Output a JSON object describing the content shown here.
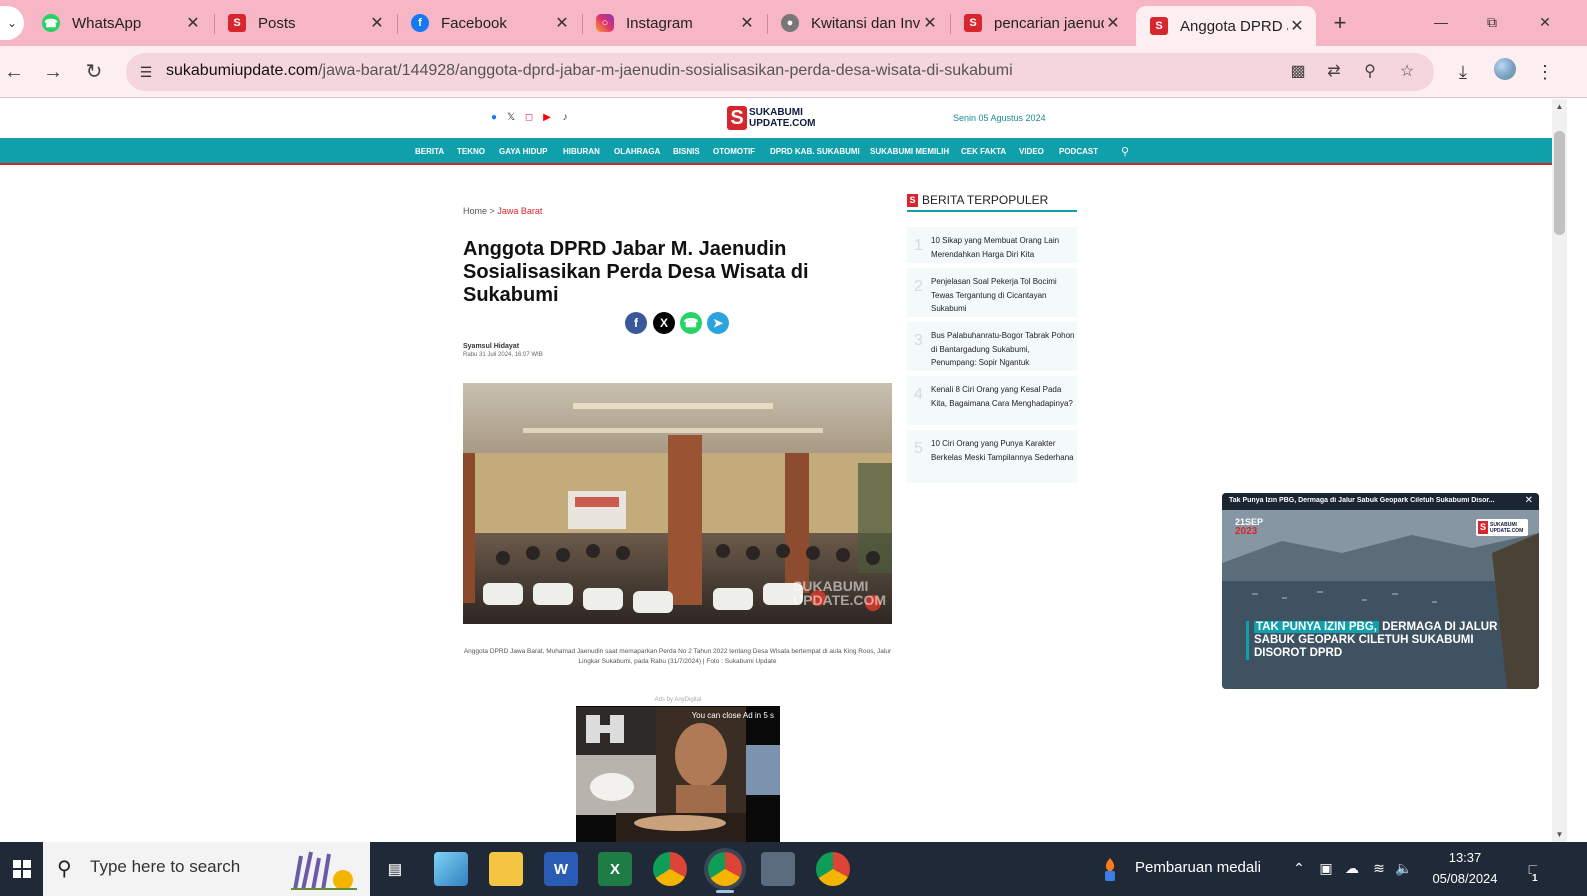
{
  "colors": {
    "accent": "#0fa0ac",
    "brand_red": "#d7262e",
    "tab_strip": "#f7b6c5",
    "toolbar": "#fdeef1"
  },
  "browser": {
    "tabs": [
      {
        "label": "WhatsApp",
        "icon": "whatsapp-icon"
      },
      {
        "label": "Posts",
        "icon": "sukabumi-icon"
      },
      {
        "label": "Facebook",
        "icon": "facebook-icon"
      },
      {
        "label": "Instagram",
        "icon": "instagram-icon"
      },
      {
        "label": "Kwitansi dan Invo",
        "icon": "globe-icon"
      },
      {
        "label": "pencarian jaenud",
        "icon": "sukabumi-icon"
      },
      {
        "label": "Anggota DPRD Ja",
        "icon": "sukabumi-icon"
      }
    ],
    "active_tab": 6,
    "url_host": "sukabumiupdate.com",
    "url_path": "/jawa-barat/144928/anggota-dprd-jabar-m-jaenudin-sosialisasikan-perda-desa-wisata-di-sukabumi"
  },
  "site": {
    "logo_line1": "SUKABUMI",
    "logo_line2": "UPDATE.COM",
    "date": "Senin 05 Agustus 2024",
    "nav": [
      "BERITA",
      "TEKNO",
      "GAYA HIDUP",
      "HIBURAN",
      "OLAHRAGA",
      "BISNIS",
      "OTOMOTIF",
      "DPRD KAB. SUKABUMI",
      "SUKABUMI MEMILIH",
      "CEK FAKTA",
      "VIDEO",
      "PODCAST"
    ]
  },
  "article": {
    "breadcrumb_home": "Home",
    "breadcrumb_sep": ">",
    "breadcrumb_current": "Jawa Barat",
    "title": "Anggota DPRD Jabar M. Jaenudin Sosialisasikan Perda Desa Wisata di Sukabumi",
    "author": "Syamsul Hidayat",
    "published": "Rabu 31 Juli 2024, 16:07 WIB",
    "photo_watermark_1": "SUKABUMI",
    "photo_watermark_2": "UPDATE.COM",
    "caption": "Anggota DPRD Jawa Barat, Muhamad Jaenudin saat memaparkan Perda No 2 Tahun 2022 tentang Desa Wisata bertempat di aula King Roos, Jalur Lingkar Sukabumi, pada Rabu (31/7/2024) | Foto : Sukabumi Update"
  },
  "ad": {
    "label": "Ads by AnyDigital",
    "close_text": "You can close Ad in 5 s"
  },
  "sidebar": {
    "title": "BERITA TERPOPULER",
    "items": [
      {
        "num": "1",
        "text": "10 Sikap yang Membuat Orang Lain Merendahkan Harga Diri Kita"
      },
      {
        "num": "2",
        "text": "Penjelasan Soal Pekerja Tol Bocimi Tewas Tergantung di Cicantayan Sukabumi"
      },
      {
        "num": "3",
        "text": "Bus Palabuhanratu-Bogor Tabrak Pohon di Bantargadung Sukabumi, Penumpang: Sopir Ngantuk"
      },
      {
        "num": "4",
        "text": "Kenali 8 Ciri Orang yang Kesal Pada Kita, Bagaimana Cara Menghadapinya?"
      },
      {
        "num": "5",
        "text": "10 Ciri Orang yang Punya Karakter Berkelas Meski Tampilannya Sederhana"
      }
    ]
  },
  "video": {
    "bar_title": "Tak Punya Izin PBG, Dermaga di Jalur Sabuk Geopark Ciletuh Sukabumi Disor...",
    "date_day": "21SEP",
    "date_year": "2023",
    "headline_highlight": "TAK PUNYA IZIN PBG,",
    "headline_rest": " DERMAGA DI JALUR SABUK GEOPARK CILETUH SUKABUMI DISOROT DPRD"
  },
  "taskbar": {
    "search_placeholder": "Type here to search",
    "widget_text": "Pembaruan medali",
    "time": "13:37",
    "date": "05/08/2024",
    "notification_count": "1",
    "word_letter": "W",
    "excel_letter": "X"
  }
}
